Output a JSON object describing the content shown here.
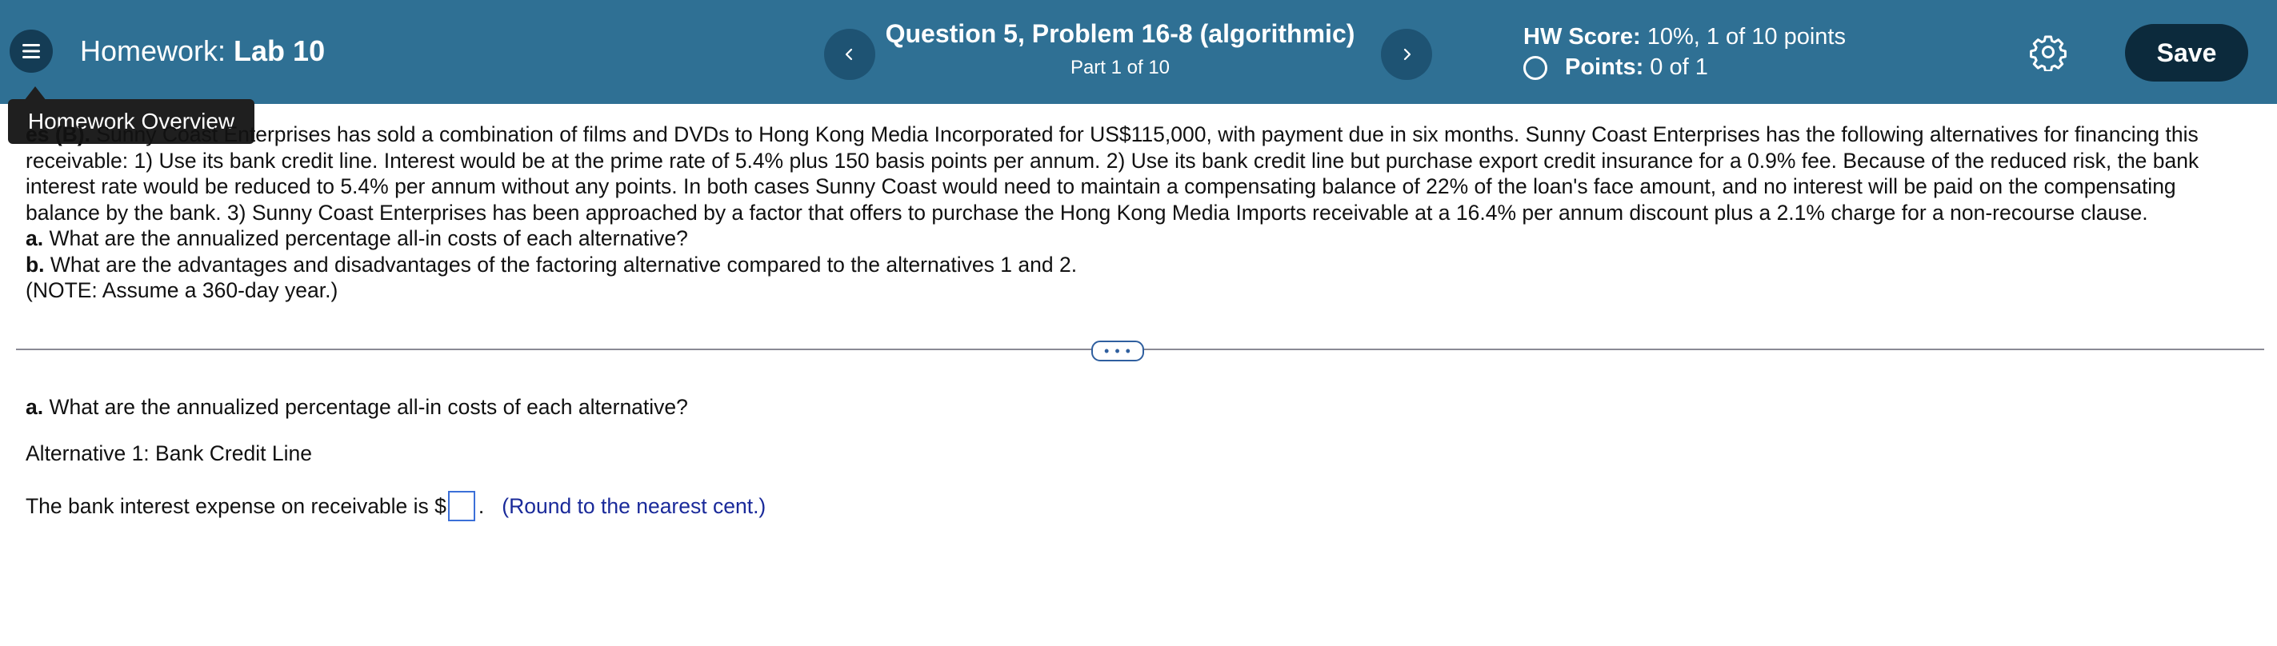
{
  "header": {
    "homework_label": "Homework:",
    "homework_name": "Lab 10",
    "question_title": "Question 5, Problem 16-8 (algorithmic)",
    "part": "Part 1 of 10",
    "hw_score_label": "HW Score:",
    "hw_score_value": "10%, 1 of 10 points",
    "points_label": "Points:",
    "points_value": "0 of 1",
    "save_label": "Save",
    "colors": {
      "bar": "#2f7094",
      "save": "#0c2a3c"
    }
  },
  "tooltip": {
    "text": "Homework Overview"
  },
  "problem": {
    "prefix_bold": "es (B).",
    "body": " Sunny Coast Enterprises has sold a combination of films and DVDs to Hong Kong Media Incorporated for US$115,000, with payment due in six months. Sunny Coast Enterprises has the following alternatives for financing this receivable: 1) Use its bank credit line. Interest would be at the prime rate of 5.4% plus 150 basis points per annum. 2) Use its bank credit line but purchase export credit insurance for a 0.9% fee. Because of the reduced risk, the bank interest rate would be reduced to 5.4% per annum without any points. In both cases Sunny Coast would need to maintain a compensating balance of 22% of the loan's face amount, and no interest will be paid on the compensating balance by the bank. 3) Sunny Coast Enterprises has been approached by a factor that offers to purchase the Hong Kong Media Imports receivable at a 16.4% per annum discount plus a 2.1% charge for a non-recourse clause.",
    "qa_label": "a.",
    "qa_text": " What are the annualized percentage all-in costs of each alternative?",
    "qb_label": "b.",
    "qb_text": " What are the advantages and disadvantages of the factoring alternative compared to the alternatives 1 and 2.",
    "note": "(NOTE: Assume a 360-day year.)"
  },
  "divider": {
    "label": "• • •"
  },
  "answer": {
    "q_label": "a.",
    "q_text": " What are the annualized percentage all-in costs of each alternative?",
    "alternative": "Alternative 1: Bank Credit Line",
    "statement_prefix": "The bank interest expense on receivable is $",
    "statement_suffix": ".",
    "input_value": "",
    "hint": "(Round to the nearest cent.)"
  }
}
